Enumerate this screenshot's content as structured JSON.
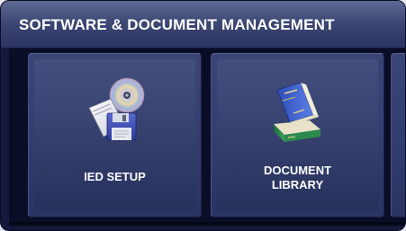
{
  "header": {
    "title": "SOFTWARE & DOCUMENT MANAGEMENT"
  },
  "tiles": [
    {
      "label": "IED SETUP",
      "icon": "software-disk-icon"
    },
    {
      "label": "DOCUMENT\nLIBRARY",
      "icon": "document-books-icon"
    }
  ],
  "colors": {
    "header": "#3e4874",
    "tile": "#344071",
    "background": "#0a0d26",
    "text": "#ffffff"
  }
}
